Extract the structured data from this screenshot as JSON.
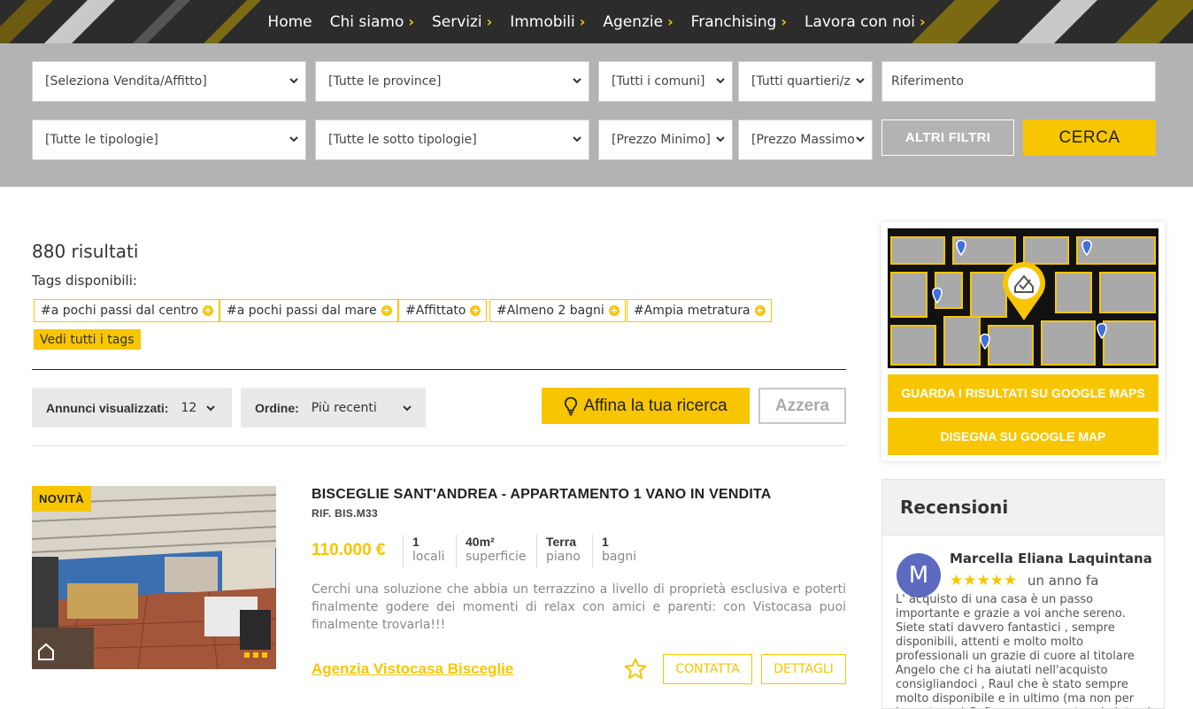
{
  "nav": {
    "items": [
      {
        "label": "Home",
        "has_chevron": false
      },
      {
        "label": "Chi siamo",
        "has_chevron": true
      },
      {
        "label": "Servizi",
        "has_chevron": true
      },
      {
        "label": "Immobili",
        "has_chevron": true
      },
      {
        "label": "Agenzie",
        "has_chevron": true
      },
      {
        "label": "Franchising",
        "has_chevron": true
      },
      {
        "label": "Lavora con noi",
        "has_chevron": true
      }
    ],
    "chevron_glyph": "›"
  },
  "search": {
    "contract": "[Seleziona Vendita/Affitto]",
    "province": "[Tutte le province]",
    "comuni": "[Tutti i comuni]",
    "quartieri": "[Tutti quartieri/z",
    "riferimento_placeholder": "Riferimento",
    "tipologie": "[Tutte le tipologie]",
    "sotto_tipologie": "[Tutte le sotto tipologie]",
    "prezzo_min": "[Prezzo Minimo]",
    "prezzo_max": "[Prezzo Massimo",
    "altri_filtri": "ALTRI FILTRI",
    "cerca": "CERCA"
  },
  "results": {
    "count_label": "880 risultati",
    "tags_label": "Tags disponibili:",
    "tags": [
      "#a pochi passi dal centro",
      "#a pochi passi dal mare",
      "#Affittato",
      "#Almeno 2 bagni",
      "#Ampia metratura"
    ],
    "see_all_tags": "Vedi tutti i tags"
  },
  "controls": {
    "per_page_label": "Annunci visualizzati:",
    "per_page_value": "12",
    "order_label": "Ordine:",
    "order_value": "Più recenti",
    "affina": "Affina la tua ricerca",
    "azzera": "Azzera"
  },
  "listing": {
    "badge": "NOVITÀ",
    "title": "BISCEGLIE SANT'ANDREA - APPARTAMENTO 1 VANO IN VENDITA",
    "ref": "RIF. BIS.M33",
    "price": "110.000 €",
    "features": [
      {
        "value": "1",
        "label": "locali"
      },
      {
        "value": "40m²",
        "label": "superficie"
      },
      {
        "value": "Terra",
        "label": "piano"
      },
      {
        "value": "1",
        "label": "bagni"
      }
    ],
    "description": "Cerchi una soluzione che abbia un terrazzino a livello di proprietà esclusiva e poterti finalmente godere dei momenti di relax con amici e parenti: con Vistocasa puoi finalmente trovarla!!!",
    "agency": "Agenzia Vistocasa Bisceglie",
    "contatta": "CONTATTA",
    "dettagli": "DETTAGLI"
  },
  "map": {
    "btn_results": "GUARDA I RISULTATI SU GOOGLE MAPS",
    "btn_draw": "DISEGNA SU GOOGLE MAP"
  },
  "reviews": {
    "title": "Recensioni",
    "avatar_letter": "M",
    "name": "Marcella Eliana Laquintana",
    "stars": "★★★★★",
    "rating": 5,
    "time": "un anno fa",
    "text": "L' acquisto di una casa è un passo importante e grazie a voi anche sereno. Siete stati davvero fantastici , sempre disponibili, attenti e molto molto professionali un grazie di cuore al titolare Angelo che ci ha aiutati nell'acquisto consigliandoci , Raul che è stato sempre molto disponibile e in ultimo (ma non per importanza) Sofia sempre pronta ad aiutarci."
  },
  "colors": {
    "accent": "#f7c600",
    "nav_bg": "#2a2a2a",
    "search_bg": "#b3b3b3",
    "avatar": "#5c6bc0"
  }
}
